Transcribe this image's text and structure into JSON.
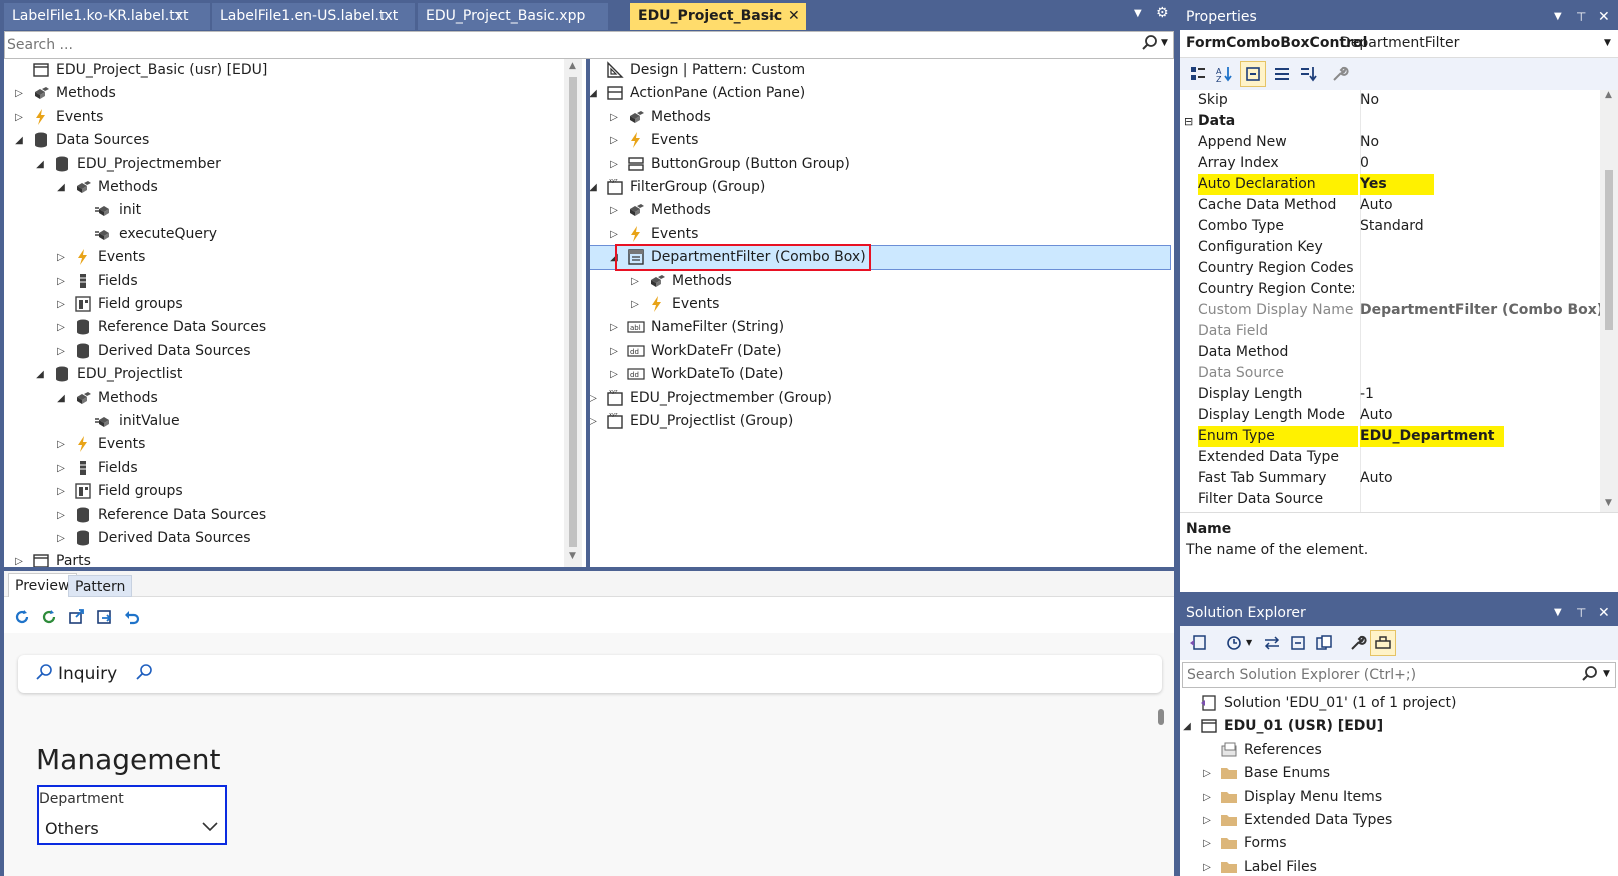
{
  "tabs": [
    {
      "label": "LabelFile1.ko-KR.label.txt",
      "pin": "⊤"
    },
    {
      "label": "LabelFile1.en-US.label.txt",
      "pin": "⊤"
    },
    {
      "label": "EDU_Project_Basic.xpp"
    },
    {
      "label": "EDU_Project_Basic",
      "pin": "⊣",
      "close": "✕"
    }
  ],
  "designer_search": {
    "placeholder": "Search ..."
  },
  "left_tree": [
    {
      "label": "EDU_Project_Basic (usr) [EDU]",
      "icon": "form-icon",
      "level": 0,
      "expander": ""
    },
    {
      "label": "Methods",
      "icon": "methods-icon",
      "level": 0,
      "expander": "collapsed"
    },
    {
      "label": "Events",
      "icon": "events-icon",
      "level": 0,
      "expander": "collapsed"
    },
    {
      "label": "Data Sources",
      "icon": "datasource-icon",
      "level": 0,
      "expander": "expanded"
    },
    {
      "label": "EDU_Projectmember",
      "icon": "datasource-icon",
      "level": 1,
      "expander": "expanded"
    },
    {
      "label": "Methods",
      "icon": "methods-icon",
      "level": 2,
      "expander": "expanded"
    },
    {
      "label": "init",
      "icon": "method-icon",
      "level": 3,
      "expander": ""
    },
    {
      "label": "executeQuery",
      "icon": "method-icon",
      "level": 3,
      "expander": ""
    },
    {
      "label": "Events",
      "icon": "events-icon",
      "level": 2,
      "expander": "collapsed"
    },
    {
      "label": "Fields",
      "icon": "fields-icon",
      "level": 2,
      "expander": "collapsed"
    },
    {
      "label": "Field groups",
      "icon": "fieldgroups-icon",
      "level": 2,
      "expander": "collapsed"
    },
    {
      "label": "Reference Data Sources",
      "icon": "datasource-icon",
      "level": 2,
      "expander": "collapsed"
    },
    {
      "label": "Derived Data Sources",
      "icon": "datasource-icon",
      "level": 2,
      "expander": "collapsed"
    },
    {
      "label": "EDU_Projectlist",
      "icon": "datasource-icon",
      "level": 1,
      "expander": "expanded"
    },
    {
      "label": "Methods",
      "icon": "methods-icon",
      "level": 2,
      "expander": "expanded"
    },
    {
      "label": "initValue",
      "icon": "method-icon",
      "level": 3,
      "expander": ""
    },
    {
      "label": "Events",
      "icon": "events-icon",
      "level": 2,
      "expander": "collapsed"
    },
    {
      "label": "Fields",
      "icon": "fields-icon",
      "level": 2,
      "expander": "collapsed"
    },
    {
      "label": "Field groups",
      "icon": "fieldgroups-icon",
      "level": 2,
      "expander": "collapsed"
    },
    {
      "label": "Reference Data Sources",
      "icon": "datasource-icon",
      "level": 2,
      "expander": "collapsed"
    },
    {
      "label": "Derived Data Sources",
      "icon": "datasource-icon",
      "level": 2,
      "expander": "collapsed"
    },
    {
      "label": "Parts",
      "icon": "form-icon",
      "level": 0,
      "expander": "collapsed"
    }
  ],
  "design_tree": [
    {
      "label": "Design | Pattern: Custom",
      "icon": "design-icon",
      "level": 0,
      "expander": ""
    },
    {
      "label": "ActionPane (Action Pane)",
      "icon": "actionpane-icon",
      "level": 0,
      "expander": "expanded"
    },
    {
      "label": "Methods",
      "icon": "methods-icon",
      "level": 1,
      "expander": "collapsed"
    },
    {
      "label": "Events",
      "icon": "events-icon",
      "level": 1,
      "expander": "collapsed"
    },
    {
      "label": "ButtonGroup (Button Group)",
      "icon": "buttongroup-icon",
      "level": 1,
      "expander": "collapsed"
    },
    {
      "label": "FilterGroup (Group)",
      "icon": "group-icon",
      "level": 0,
      "expander": "expanded"
    },
    {
      "label": "Methods",
      "icon": "methods-icon",
      "level": 1,
      "expander": "collapsed"
    },
    {
      "label": "Events",
      "icon": "events-icon",
      "level": 1,
      "expander": "collapsed"
    },
    {
      "label": "DepartmentFilter (Combo Box)",
      "icon": "combobox-icon",
      "level": 1,
      "expander": "expanded",
      "selected": true
    },
    {
      "label": "Methods",
      "icon": "methods-icon",
      "level": 2,
      "expander": "collapsed"
    },
    {
      "label": "Events",
      "icon": "events-icon",
      "level": 2,
      "expander": "collapsed"
    },
    {
      "label": "NameFilter (String)",
      "icon": "string-icon",
      "level": 1,
      "expander": "collapsed"
    },
    {
      "label": "WorkDateFr (Date)",
      "icon": "date-icon",
      "level": 1,
      "expander": "collapsed"
    },
    {
      "label": "WorkDateTo (Date)",
      "icon": "date-icon",
      "level": 1,
      "expander": "collapsed"
    },
    {
      "label": "EDU_Projectmember (Group)",
      "icon": "group-icon",
      "level": 0,
      "expander": "collapsed"
    },
    {
      "label": "EDU_Projectlist (Group)",
      "icon": "group-icon",
      "level": 0,
      "expander": "collapsed"
    }
  ],
  "preview": {
    "tabs": [
      "Preview",
      "Pattern"
    ],
    "filter_label": "Inquiry",
    "heading": "Management",
    "field_label": "Department",
    "field_value": "Others"
  },
  "properties": {
    "title": "Properties",
    "object_type": "FormComboBoxControl",
    "object_name": "DepartmentFilter",
    "rows": [
      {
        "name": "Skip",
        "value": "No"
      },
      {
        "name": "Data",
        "value": "",
        "category": true
      },
      {
        "name": "Append New",
        "value": "No"
      },
      {
        "name": "Array Index",
        "value": "0"
      },
      {
        "name": "Auto Declaration",
        "value": "Yes",
        "highlight": true
      },
      {
        "name": "Cache Data Method",
        "value": "Auto"
      },
      {
        "name": "Combo Type",
        "value": "Standard"
      },
      {
        "name": "Configuration Key",
        "value": ""
      },
      {
        "name": "Country Region Codes",
        "value": ""
      },
      {
        "name": "Country Region Context F",
        "value": ""
      },
      {
        "name": "Custom Display Name",
        "value": "DepartmentFilter (Combo Box)",
        "disabled": true
      },
      {
        "name": "Data Field",
        "value": "",
        "disabled": true
      },
      {
        "name": "Data Method",
        "value": ""
      },
      {
        "name": "Data Source",
        "value": "",
        "disabled": true
      },
      {
        "name": "Display Length",
        "value": "-1"
      },
      {
        "name": "Display Length Mode",
        "value": "Auto"
      },
      {
        "name": "Enum Type",
        "value": "EDU_Department",
        "highlight": true
      },
      {
        "name": "Extended Data Type",
        "value": ""
      },
      {
        "name": "Fast Tab Summary",
        "value": "Auto"
      },
      {
        "name": "Filter Data Source",
        "value": ""
      }
    ],
    "desc_title": "Name",
    "desc_text": "The name of the element."
  },
  "solution_explorer": {
    "title": "Solution Explorer",
    "search_placeholder": "Search Solution Explorer (Ctrl+;)",
    "items": [
      {
        "label": "Solution 'EDU_01' (1 of 1 project)",
        "icon": "solution-icon",
        "level": 0,
        "expander": ""
      },
      {
        "label": "EDU_01 (USR) [EDU]",
        "icon": "project-icon",
        "level": 0,
        "expander": "expanded",
        "bold": true
      },
      {
        "label": "References",
        "icon": "references-icon",
        "level": 1,
        "expander": ""
      },
      {
        "label": "Base Enums",
        "icon": "folder-icon",
        "level": 1,
        "expander": "collapsed"
      },
      {
        "label": "Display Menu Items",
        "icon": "folder-icon",
        "level": 1,
        "expander": "collapsed"
      },
      {
        "label": "Extended Data Types",
        "icon": "folder-icon",
        "level": 1,
        "expander": "collapsed"
      },
      {
        "label": "Forms",
        "icon": "folder-icon",
        "level": 1,
        "expander": "collapsed"
      },
      {
        "label": "Label Files",
        "icon": "folder-icon",
        "level": 1,
        "expander": "collapsed"
      }
    ]
  },
  "colors": {
    "chrome": "#4c6292",
    "active_tab": "#ffdc6c",
    "selection": "#cce8ff",
    "highlight": "#fff100",
    "annotation_red": "#e81123",
    "focus_blue": "#0a2be0"
  }
}
